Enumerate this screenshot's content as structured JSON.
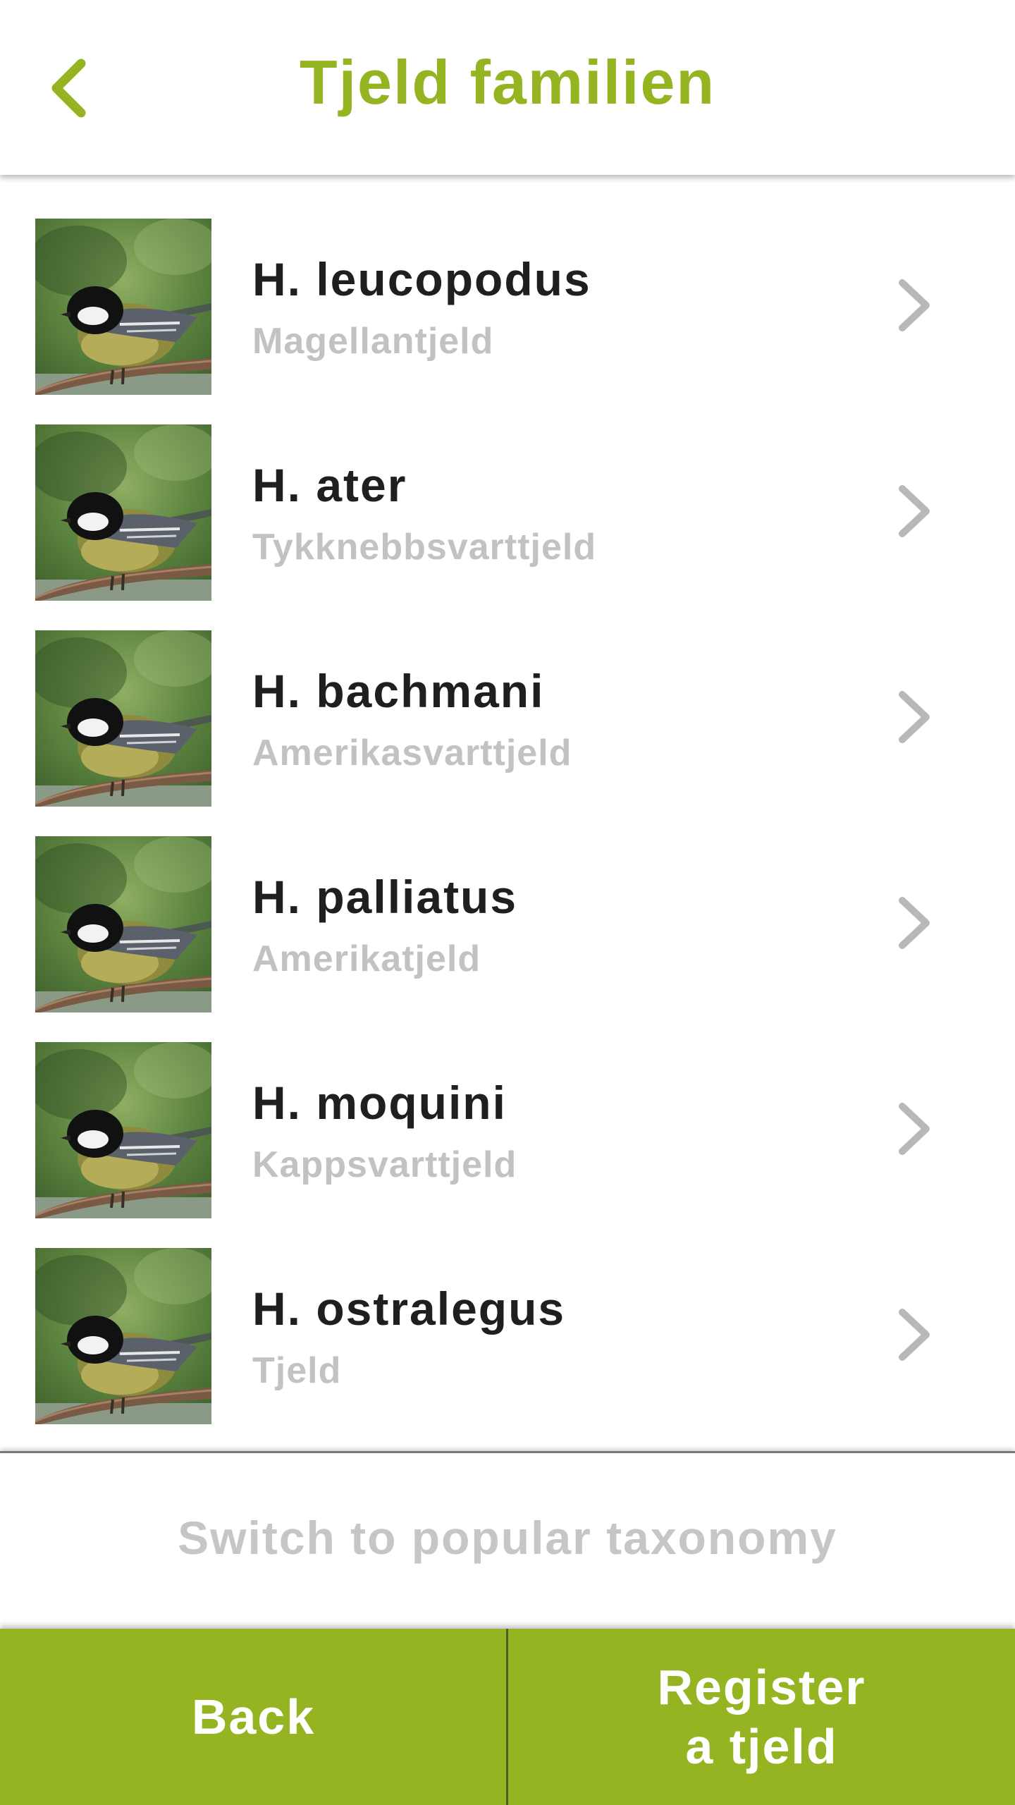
{
  "header": {
    "title": "Tjeld familien",
    "back_icon": "chevron-left-icon"
  },
  "species": [
    {
      "scientific": "H. leucopodus",
      "common": "Magellantjeld"
    },
    {
      "scientific": "H. ater",
      "common": "Tykknebbsvarttjeld"
    },
    {
      "scientific": "H. bachmani",
      "common": "Amerikasvarttjeld"
    },
    {
      "scientific": "H. palliatus",
      "common": "Amerikatjeld"
    },
    {
      "scientific": "H. moquini",
      "common": "Kappsvarttjeld"
    },
    {
      "scientific": "H. ostralegus",
      "common": "Tjeld"
    }
  ],
  "switch_taxonomy_label": "Switch to popular taxonomy",
  "footer": {
    "back_label": "Back",
    "register_line1": "Register",
    "register_line2": "a tjeld"
  },
  "colors": {
    "accent": "#95b421",
    "text_primary": "#1f1f1f",
    "text_secondary": "#c2c2c2"
  }
}
